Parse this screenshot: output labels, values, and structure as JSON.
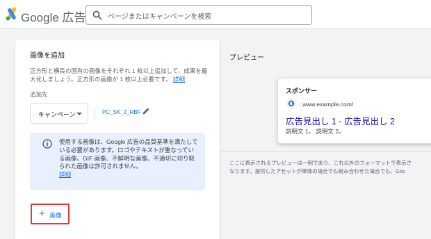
{
  "header": {
    "brand_name": "Google 広告",
    "search_placeholder": "ページまたはキャンペーンを検索"
  },
  "left_panel": {
    "title": "画像を追加",
    "description_text": "正方形と横長の固有の画像をそれぞれ 1 枚以上追加して、成果を最大化しましょう。正方形の画像が 1 枚以上必要です。",
    "description_link": "詳細",
    "destination_label": "追加先",
    "campaign_select_value": "キャンペーン",
    "campaign_name": "PC_SK_2_RBF",
    "notice_text": "使用する画像は、Google 広告の品質基準を満たしている必要があります。ロゴやテキストが重なっている画像、GIF 画像、不鮮明な画像、不適切に切り取られた画像は許可されません。",
    "notice_link": "詳細",
    "add_image_plus": "+",
    "add_image_label": "画像"
  },
  "preview": {
    "title": "プレビュー",
    "ad": {
      "sponsor_label": "スポンサー",
      "domain": "www.example.com/",
      "headline": "広告見出し 1 - 広告見出し 2",
      "description": "説明文 1。 説明文 2。"
    },
    "disclaimer_line1": "ここに表示されるプレビューは一例であり、これ以外のフォーマットで表示さ",
    "disclaimer_line2": "なります。提供したアセットが単体の場合でも組み合わせた場合でも、Goo"
  },
  "colors": {
    "accent_blue": "#1a73e8",
    "ad_headline": "#1a0dab",
    "notice_bg": "#e8f0fe",
    "highlight_border": "#e53935"
  },
  "icons": {
    "logo": "google-ads-logo-icon",
    "search": "search-icon",
    "edit": "pencil-icon",
    "info": "info-icon",
    "site": "globe-icon"
  }
}
